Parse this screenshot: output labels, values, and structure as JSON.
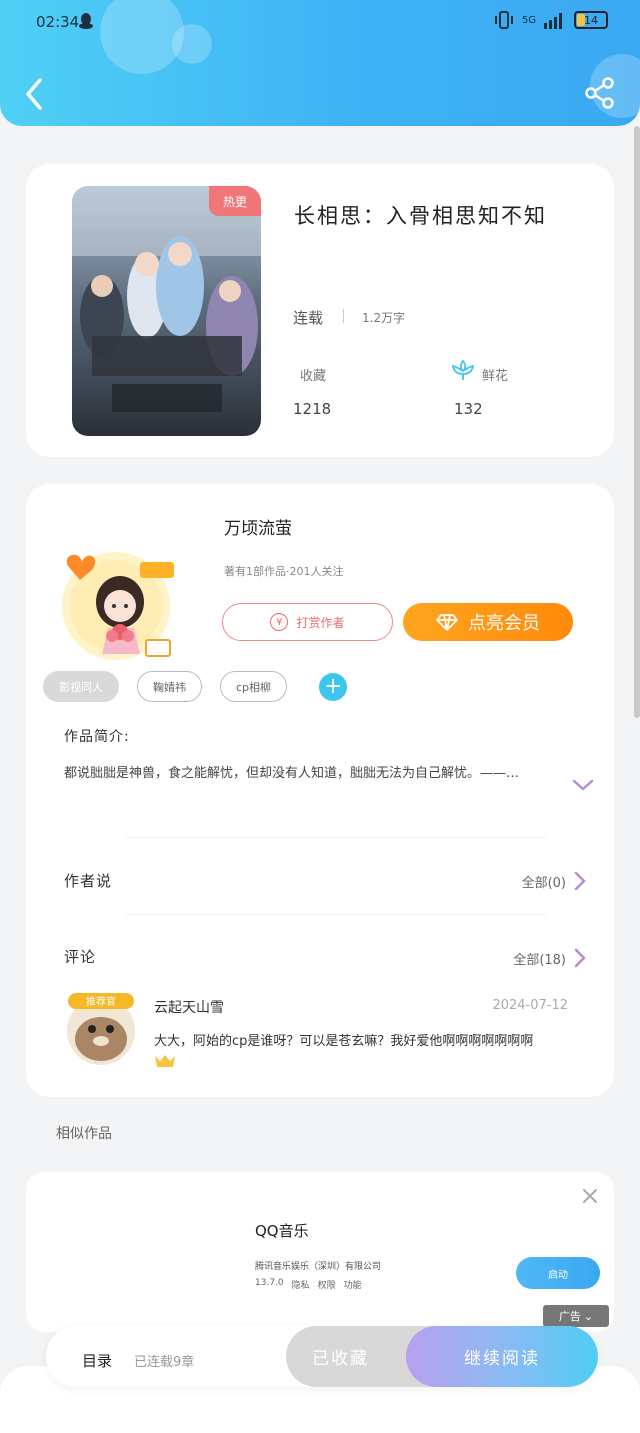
{
  "status_bar": {
    "time": "02:34",
    "signal": "5G",
    "battery": "14"
  },
  "book": {
    "title": "长相思：入骨相思知不知",
    "badge": "热更",
    "status": "连载",
    "word_count": "1.2万字",
    "favorites_label": "收藏",
    "favorites_value": "1218",
    "flowers_label": "鲜花",
    "flowers_value": "132"
  },
  "author": {
    "name": "万顷流萤",
    "meta": "著有1部作品·201人关注",
    "tip_button": "打赏作者",
    "vip_button": "点亮会员",
    "tags": [
      "影视同人",
      "鞠婧祎",
      "cp相柳"
    ],
    "intro_label": "作品简介:",
    "intro_text": "都说朏朏是神兽，食之能解忧，但却没有人知道，朏朏无法为自己解忧。——…",
    "author_says_label": "作者说",
    "author_says_all": "全部(0)",
    "comments_label": "评论",
    "comments_all": "全部(18)"
  },
  "comment": {
    "badge": "推荐官",
    "name": "云起天山雪",
    "date": "2024-07-12",
    "text": "大大，阿始的cp是谁呀？可以是苍玄嘛？我好爱他啊啊啊啊啊啊啊"
  },
  "similar_label": "相似作品",
  "ad": {
    "title": "QQ音乐",
    "company": "腾讯音乐娱乐（深圳）有限公司",
    "meta": [
      "13.7.0",
      "隐私",
      "权限",
      "功能"
    ],
    "launch": "启动",
    "badge": "广告"
  },
  "bottom_bar": {
    "toc_label": "目录",
    "toc_count": "已连载9章",
    "collected": "已收藏",
    "continue": "继续阅读"
  },
  "colors": {
    "header": "#3fb3f5",
    "accent_orange": "#ff8a0a",
    "accent_cyan": "#3cc6ef",
    "hot_badge": "#f07677"
  },
  "icons": [
    "back-arrow-icon",
    "share-icon",
    "flower-icon",
    "yen-icon",
    "diamond-icon",
    "plus-icon",
    "chevron-down-icon",
    "chevron-right-icon",
    "close-icon"
  ]
}
